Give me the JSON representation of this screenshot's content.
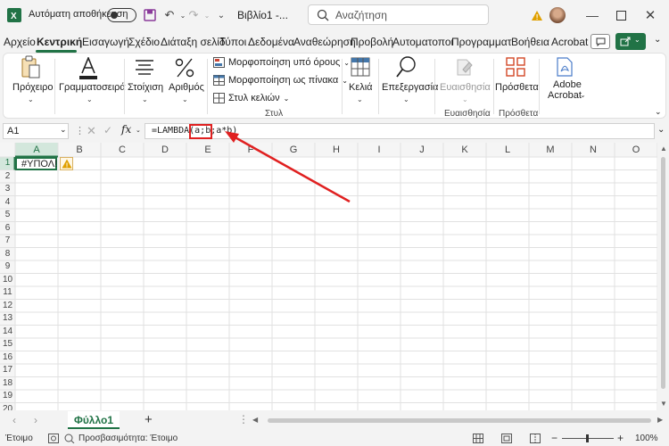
{
  "titlebar": {
    "autosave_label": "Αυτόματη αποθήκευση",
    "workbook_name": "Βιβλίο1 -...",
    "search_placeholder": "Αναζήτηση",
    "accent": "#217346"
  },
  "tabs": [
    "Αρχείο",
    "Κεντρική",
    "Εισαγωγή",
    "Σχέδιο",
    "Διάταξη σελίδ",
    "Τύποι",
    "Δεδομένα",
    "Αναθεώρηση",
    "Προβολή",
    "Αυτοματοποι",
    "Προγραμματ",
    "Βοήθεια",
    "Acrobat"
  ],
  "ribbon": {
    "clipboard": "Πρόχειρο",
    "font": "Γραμματοσειρά",
    "alignment": "Στοίχιση",
    "number": "Αριθμός",
    "cond_format": "Μορφοποίηση υπό όρους",
    "format_table": "Μορφοποίηση ως πίνακα",
    "cell_styles": "Στυλ κελιών",
    "styles_group": "Στυλ",
    "cells": "Κελιά",
    "editing": "Επεξεργασία",
    "sensitivity": "Ευαισθησία",
    "sensitivity_group": "Ευαισθησία",
    "addins": "Πρόσθετα",
    "addins_group": "Πρόσθετα",
    "adobe1": "Adobe",
    "adobe2": "Acrobat"
  },
  "formula_bar": {
    "name_box": "A1",
    "fx": "fx",
    "formula": "=LAMBDA(a;b;a*b)"
  },
  "grid": {
    "columns": [
      "A",
      "B",
      "C",
      "D",
      "E",
      "F",
      "G",
      "H",
      "I",
      "J",
      "K",
      "L",
      "M",
      "N",
      "O"
    ],
    "rows": [
      "1",
      "2",
      "3",
      "4",
      "5",
      "6",
      "7",
      "8",
      "9",
      "10",
      "11",
      "12",
      "13",
      "14",
      "15",
      "16",
      "17",
      "18",
      "19",
      "20"
    ],
    "cell_a1": "#ΥΠΟΛ!"
  },
  "sheets": {
    "tab": "Φύλλο1",
    "add": "+"
  },
  "status": {
    "ready": "Έτοιμο",
    "accessibility": "Προσβασιμότητα: Έτοιμο",
    "zoom": "100%"
  }
}
